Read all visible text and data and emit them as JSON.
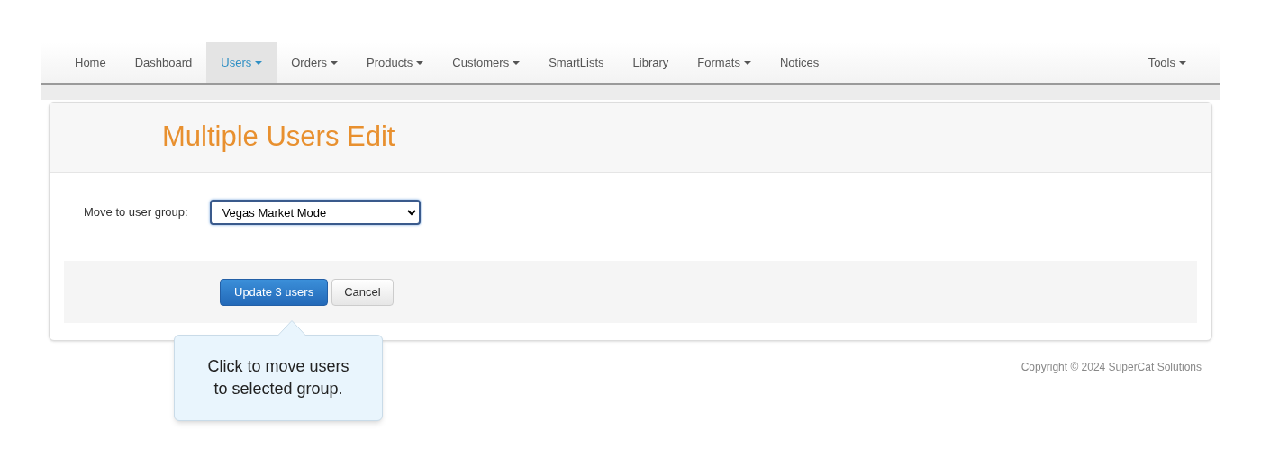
{
  "nav": {
    "items": [
      {
        "label": "Home",
        "selected": false,
        "dropdown": false
      },
      {
        "label": "Dashboard",
        "selected": false,
        "dropdown": false
      },
      {
        "label": "Users",
        "selected": true,
        "dropdown": true
      },
      {
        "label": "Orders",
        "selected": false,
        "dropdown": true
      },
      {
        "label": "Products",
        "selected": false,
        "dropdown": true
      },
      {
        "label": "Customers",
        "selected": false,
        "dropdown": true
      },
      {
        "label": "SmartLists",
        "selected": false,
        "dropdown": false
      },
      {
        "label": "Library",
        "selected": false,
        "dropdown": false
      },
      {
        "label": "Formats",
        "selected": false,
        "dropdown": true
      },
      {
        "label": "Notices",
        "selected": false,
        "dropdown": false
      }
    ],
    "right_items": [
      {
        "label": "Tools",
        "selected": false,
        "dropdown": true
      }
    ]
  },
  "panel": {
    "title": "Multiple Users Edit",
    "field": {
      "label": "Move to user group:",
      "value": "Vegas Market Mode"
    },
    "buttons": [
      {
        "label": "Update 3 users",
        "kind": "primary"
      },
      {
        "label": "Cancel",
        "kind": "default"
      }
    ]
  },
  "tooltip": {
    "text": "Click to move users to selected group."
  },
  "footer": {
    "copyright": "Copyright © 2024 SuperCat Solutions"
  }
}
